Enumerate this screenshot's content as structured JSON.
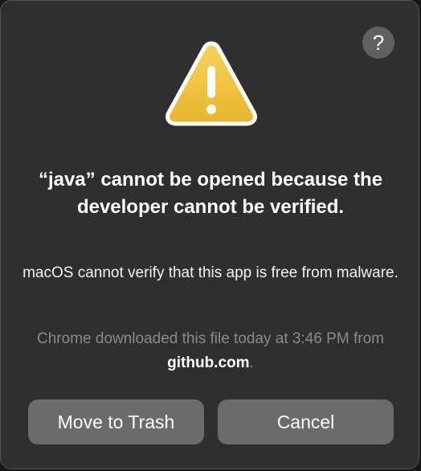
{
  "dialog": {
    "help_icon": "question-mark-icon",
    "help_label": "?",
    "warning_icon": "warning-triangle-icon",
    "title": "“java” cannot be opened because the developer cannot be verified.",
    "message": "macOS cannot verify that this app is free from malware.",
    "source_note": {
      "prefix": "Chrome downloaded this file today at 3:46 PM from ",
      "domain": "github.com",
      "suffix": "."
    },
    "buttons": {
      "move_to_trash": "Move to Trash",
      "cancel": "Cancel"
    },
    "colors": {
      "background": "#2f2f2f",
      "button": "#6b6b6b",
      "warning_fill": "#f2c33a",
      "secondary_text": "#8a8a8a"
    }
  }
}
